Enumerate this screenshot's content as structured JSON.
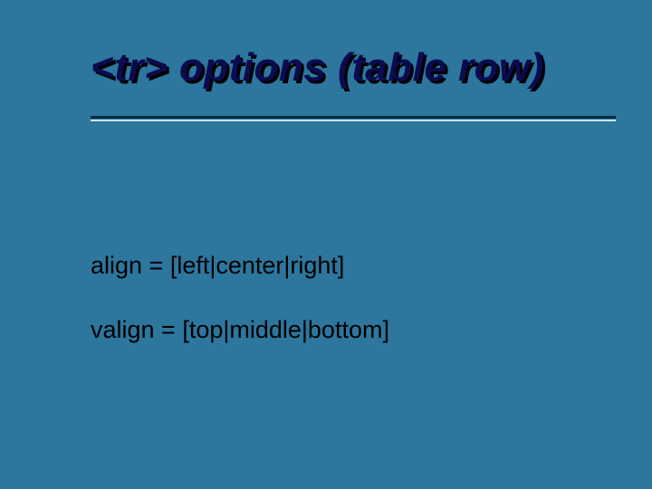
{
  "slide": {
    "title": "<tr> options (table row)",
    "lines": [
      "align = [left|center|right]",
      "valign = [top|middle|bottom]"
    ]
  }
}
